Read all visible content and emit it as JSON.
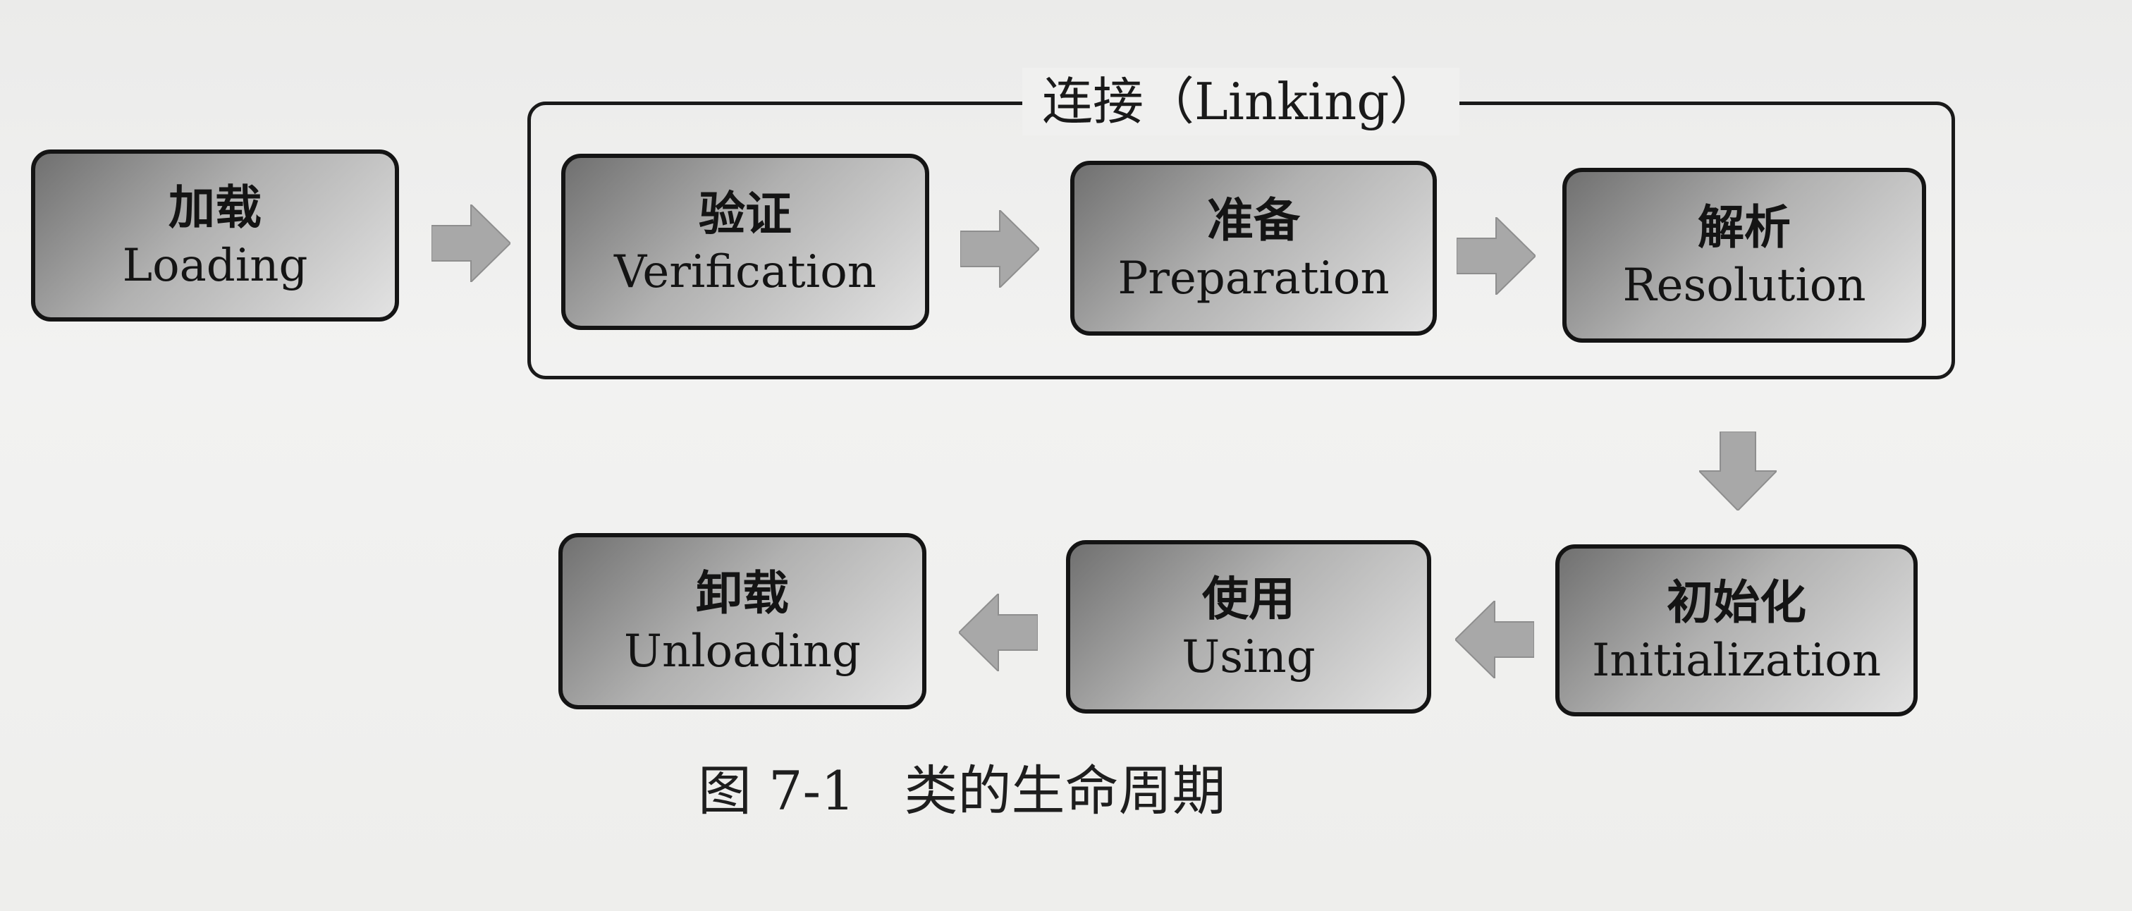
{
  "group": {
    "title": "连接（Linking）"
  },
  "stages": {
    "loading": {
      "cn": "加载",
      "en": "Loading"
    },
    "verification": {
      "cn": "验证",
      "en": "Verification"
    },
    "preparation": {
      "cn": "准备",
      "en": "Preparation"
    },
    "resolution": {
      "cn": "解析",
      "en": "Resolution"
    },
    "initialization": {
      "cn": "初始化",
      "en": "Initialization"
    },
    "using": {
      "cn": "使用",
      "en": "Using"
    },
    "unloading": {
      "cn": "卸载",
      "en": "Unloading"
    }
  },
  "caption": {
    "label": "图 7-1",
    "text": "类的生命周期"
  },
  "colors": {
    "border": "#141414",
    "arrow": "#a8a8a8",
    "background": "#efefee"
  }
}
